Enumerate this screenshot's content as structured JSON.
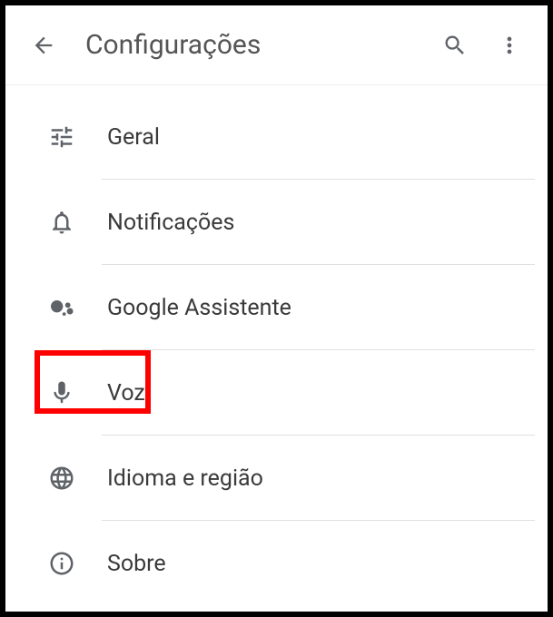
{
  "header": {
    "title": "Configurações"
  },
  "menu": {
    "items": [
      {
        "label": "Geral",
        "icon": "sliders-icon"
      },
      {
        "label": "Notificações",
        "icon": "bell-icon"
      },
      {
        "label": "Google Assistente",
        "icon": "assistant-icon"
      },
      {
        "label": "Voz",
        "icon": "mic-icon"
      },
      {
        "label": "Idioma e região",
        "icon": "globe-icon"
      },
      {
        "label": "Sobre",
        "icon": "info-icon"
      }
    ]
  },
  "highlight": {
    "target_index": 3
  }
}
